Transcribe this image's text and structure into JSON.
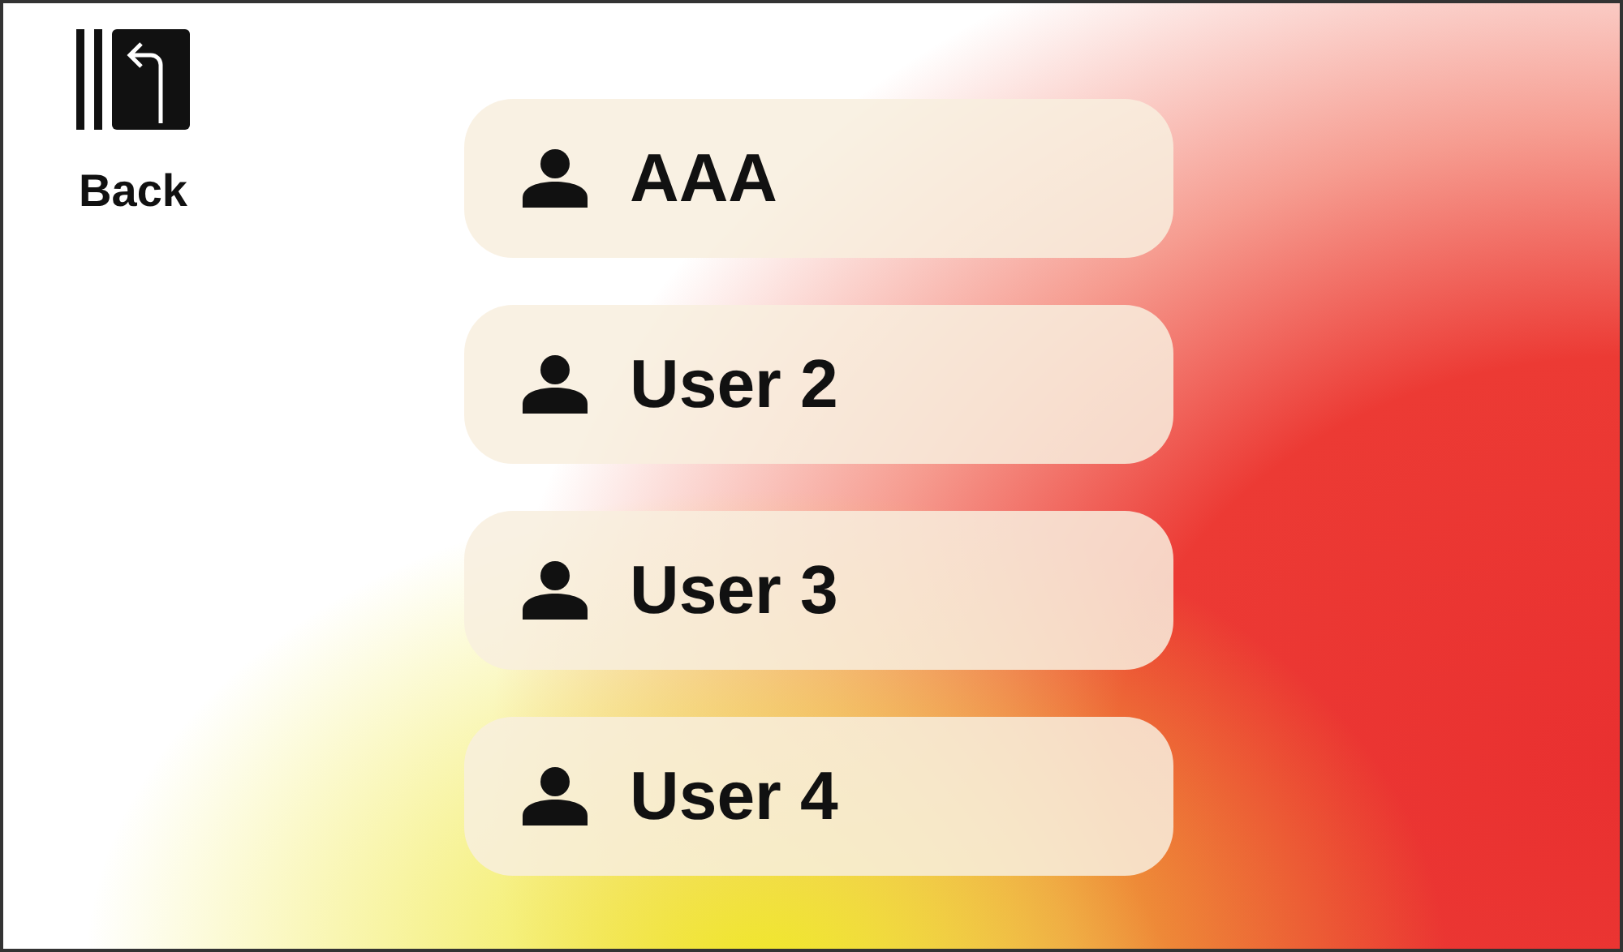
{
  "back": {
    "label": "Back"
  },
  "users": [
    {
      "name": "AAA"
    },
    {
      "name": "User 2"
    },
    {
      "name": "User 3"
    },
    {
      "name": "User 4"
    }
  ]
}
